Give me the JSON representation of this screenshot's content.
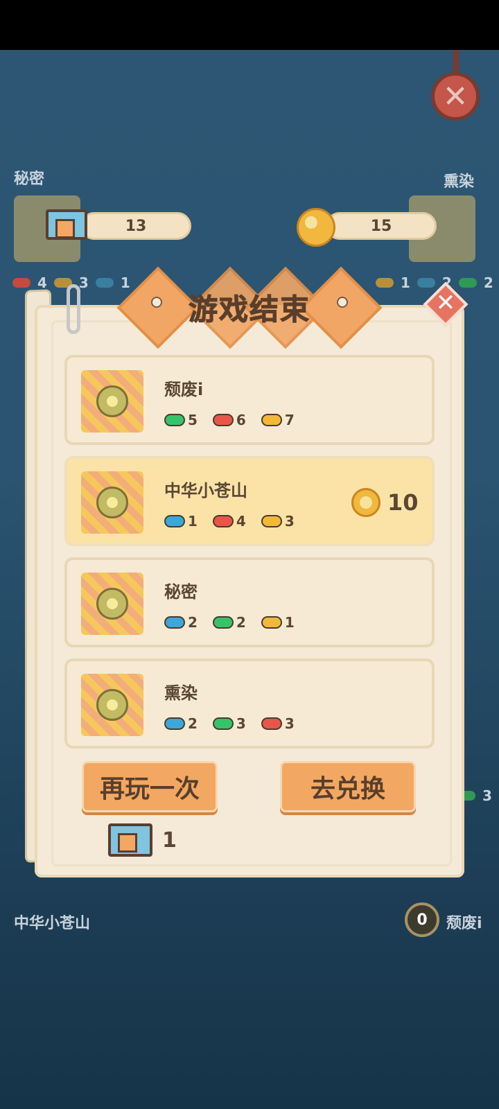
{
  "background": {
    "top_left_name": "秘密",
    "top_right_name": "熏染",
    "bottom_left_name": "中华小苍山",
    "bottom_right_name": "颓废i",
    "bottom_right_score": "0",
    "ticket_counter": "13",
    "coin_counter": "15",
    "top_left_chips": [
      "4",
      "3",
      "1"
    ],
    "top_right_chips": [
      "1",
      "2",
      "2"
    ],
    "side_chip": "3",
    "close_icon": "close-icon"
  },
  "dialog": {
    "title": "游戏结束",
    "players": [
      {
        "name": "颓废i",
        "chips": [
          {
            "color": "#35c46a",
            "count": "5"
          },
          {
            "color": "#e8564a",
            "count": "6"
          },
          {
            "color": "#f2b83a",
            "count": "7"
          }
        ],
        "highlight": false,
        "reward": null
      },
      {
        "name": "中华小苍山",
        "chips": [
          {
            "color": "#3aa8d8",
            "count": "1"
          },
          {
            "color": "#e8564a",
            "count": "4"
          },
          {
            "color": "#f2b83a",
            "count": "3"
          }
        ],
        "highlight": true,
        "reward": "10"
      },
      {
        "name": "秘密",
        "chips": [
          {
            "color": "#3aa8d8",
            "count": "2"
          },
          {
            "color": "#35c46a",
            "count": "2"
          },
          {
            "color": "#f2b83a",
            "count": "1"
          }
        ],
        "highlight": false,
        "reward": null
      },
      {
        "name": "熏染",
        "chips": [
          {
            "color": "#3aa8d8",
            "count": "2"
          },
          {
            "color": "#35c46a",
            "count": "3"
          },
          {
            "color": "#e8564a",
            "count": "3"
          }
        ],
        "highlight": false,
        "reward": null
      }
    ],
    "play_again_label": "再玩一次",
    "exchange_label": "去兑换",
    "ticket_count": "1"
  }
}
